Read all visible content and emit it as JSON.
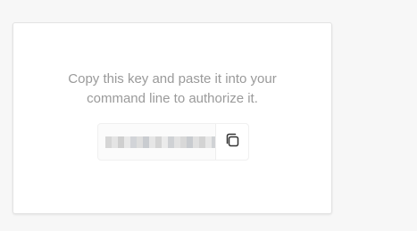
{
  "authorize_card": {
    "message_line1": "Copy this key and paste it into your",
    "message_line2": "command line to authorize it.",
    "key_value": "",
    "key_obscured": true,
    "copy_icon": "copy-icon"
  },
  "colors": {
    "page_background": "#f7f7f7",
    "card_background": "#ffffff",
    "message_text": "#9a9a9a",
    "icon_stroke": "#333333"
  }
}
